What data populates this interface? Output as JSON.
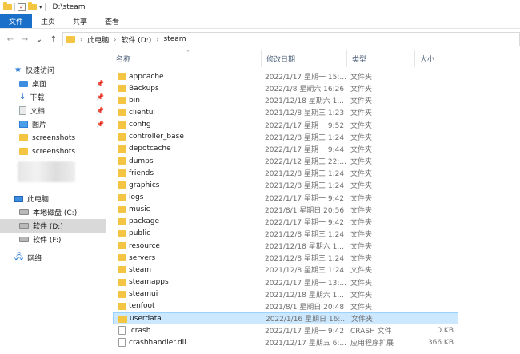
{
  "window": {
    "title": "D:\\steam"
  },
  "ribbon": {
    "tabs": [
      "文件",
      "主页",
      "共享",
      "查看"
    ]
  },
  "address": {
    "crumbs": [
      "此电脑",
      "软件 (D:)",
      "steam"
    ]
  },
  "nav": {
    "quick_access": "快速访问",
    "pinned": [
      "桌面",
      "下载",
      "文档",
      "图片"
    ],
    "recent": [
      "screenshots",
      "screenshots"
    ],
    "this_pc": "此电脑",
    "drives": [
      "本地磁盘 (C:)",
      "软件 (D:)",
      "软件 (F:)"
    ],
    "network": "网络"
  },
  "columns": {
    "name": "名称",
    "date": "修改日期",
    "type": "类型",
    "size": "大小"
  },
  "files": [
    {
      "name": "appcache",
      "date": "2022/1/17 星期一 15:...",
      "type": "文件夹",
      "size": ""
    },
    {
      "name": "Backups",
      "date": "2022/1/8 星期六 16:26",
      "type": "文件夹",
      "size": ""
    },
    {
      "name": "bin",
      "date": "2021/12/18 星期六 1...",
      "type": "文件夹",
      "size": ""
    },
    {
      "name": "clientui",
      "date": "2021/12/8 星期三 1:23",
      "type": "文件夹",
      "size": ""
    },
    {
      "name": "config",
      "date": "2022/1/17 星期一 9:52",
      "type": "文件夹",
      "size": ""
    },
    {
      "name": "controller_base",
      "date": "2021/12/8 星期三 1:24",
      "type": "文件夹",
      "size": ""
    },
    {
      "name": "depotcache",
      "date": "2022/1/17 星期一 9:44",
      "type": "文件夹",
      "size": ""
    },
    {
      "name": "dumps",
      "date": "2022/1/12 星期三 22:...",
      "type": "文件夹",
      "size": ""
    },
    {
      "name": "friends",
      "date": "2021/12/8 星期三 1:24",
      "type": "文件夹",
      "size": ""
    },
    {
      "name": "graphics",
      "date": "2021/12/8 星期三 1:24",
      "type": "文件夹",
      "size": ""
    },
    {
      "name": "logs",
      "date": "2022/1/17 星期一 9:42",
      "type": "文件夹",
      "size": ""
    },
    {
      "name": "music",
      "date": "2021/8/1 星期日 20:56",
      "type": "文件夹",
      "size": ""
    },
    {
      "name": "package",
      "date": "2022/1/17 星期一 9:42",
      "type": "文件夹",
      "size": ""
    },
    {
      "name": "public",
      "date": "2021/12/8 星期三 1:24",
      "type": "文件夹",
      "size": ""
    },
    {
      "name": "resource",
      "date": "2021/12/18 星期六 1...",
      "type": "文件夹",
      "size": ""
    },
    {
      "name": "servers",
      "date": "2021/12/8 星期三 1:24",
      "type": "文件夹",
      "size": ""
    },
    {
      "name": "steam",
      "date": "2021/12/8 星期三 1:24",
      "type": "文件夹",
      "size": ""
    },
    {
      "name": "steamapps",
      "date": "2022/1/17 星期一 13:...",
      "type": "文件夹",
      "size": ""
    },
    {
      "name": "steamui",
      "date": "2021/12/18 星期六 1...",
      "type": "文件夹",
      "size": ""
    },
    {
      "name": "tenfoot",
      "date": "2021/8/1 星期日 20:48",
      "type": "文件夹",
      "size": ""
    },
    {
      "name": "userdata",
      "date": "2022/1/16 星期日 16:...",
      "type": "文件夹",
      "size": ""
    },
    {
      "name": ".crash",
      "date": "2022/1/17 星期一 9:42",
      "type": "CRASH 文件",
      "size": "0 KB"
    },
    {
      "name": "crashhandler.dll",
      "date": "2021/12/17 星期五 6:...",
      "type": "应用程序扩展",
      "size": "366 KB"
    }
  ],
  "selected_index": 20,
  "colors": {
    "accent": "#1a6fc9",
    "selection": "#cce8ff",
    "folder": "#f4c542"
  }
}
